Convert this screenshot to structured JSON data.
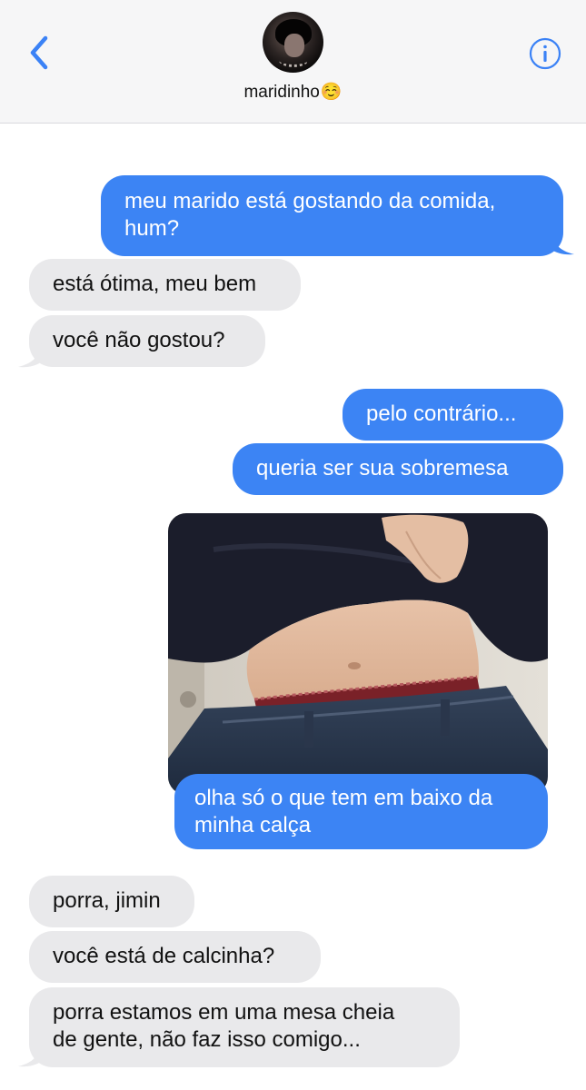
{
  "header": {
    "contact_name": "maridinho",
    "contact_emoji": "☺️",
    "back_icon": "chevron-left-icon",
    "info_icon": "info-icon",
    "accent_color": "#3b82f6"
  },
  "messages": [
    {
      "direction": "sent",
      "text_lines": [
        "meu marido está gostando da comida,",
        "hum?"
      ]
    },
    {
      "direction": "received",
      "text_lines": [
        "está ótima, meu bem"
      ]
    },
    {
      "direction": "received",
      "text_lines": [
        "você não gostou?"
      ]
    },
    {
      "direction": "sent",
      "text_lines": [
        "pelo contrário..."
      ]
    },
    {
      "direction": "sent",
      "text_lines": [
        "queria ser sua sobremesa"
      ]
    },
    {
      "direction": "sent",
      "type": "image"
    },
    {
      "direction": "sent",
      "text_lines": [
        "olha só o que tem em baixo da",
        "minha calça"
      ]
    },
    {
      "direction": "received",
      "text_lines": [
        "porra, jimin"
      ]
    },
    {
      "direction": "received",
      "text_lines": [
        "você está de calcinha?"
      ]
    },
    {
      "direction": "received",
      "text_lines": [
        "porra estamos em uma mesa cheia",
        "de gente, não faz isso comigo..."
      ]
    }
  ],
  "colors": {
    "sent_bubble": "#3c84f4",
    "received_bubble": "#e9e9eb"
  }
}
